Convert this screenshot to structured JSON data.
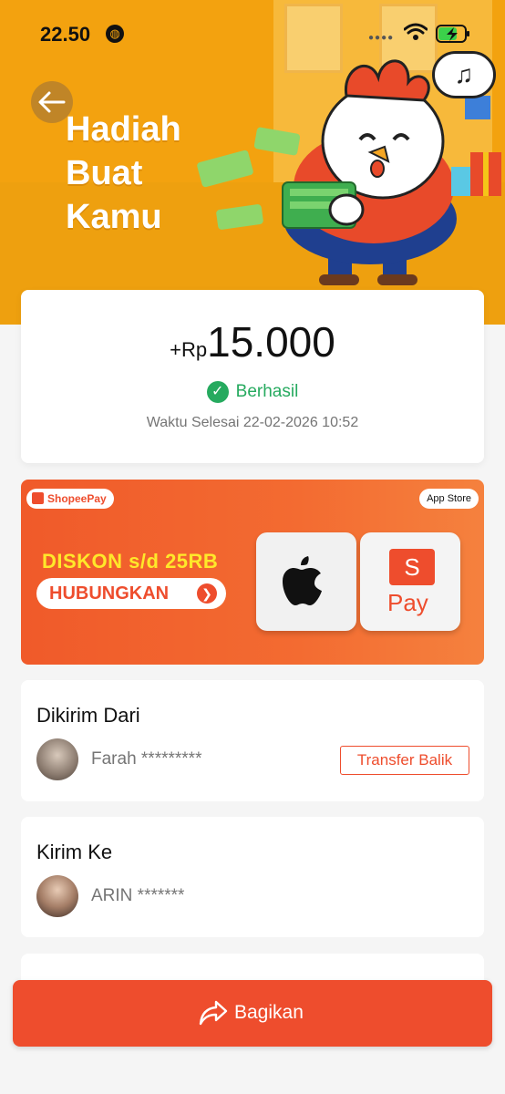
{
  "status_bar": {
    "time": "22.50"
  },
  "header": {
    "title_lines": [
      "Hadiah",
      "Buat",
      "Kamu"
    ],
    "music_glyph": "♫"
  },
  "summary": {
    "amount_prefix": "+Rp",
    "amount_value": "15.000",
    "status": "Berhasil",
    "completed_time": "Waktu Selesai 22-02-2026 10:52"
  },
  "promo": {
    "wallet_badge": "ShopeePay",
    "store_badge": "App Store",
    "discount": "DISKON s/d 25RB",
    "cta": "HUBUNGKAN",
    "pay_letter": "S",
    "pay_text": "Pay"
  },
  "sender": {
    "title": "Dikirim Dari",
    "name": "Farah *********",
    "action": "Transfer Balik"
  },
  "receiver": {
    "title": "Kirim Ke",
    "name": "ARIN *******"
  },
  "footer": {
    "share_label": "Bagikan"
  },
  "icons": {
    "back": "arrow-left-icon",
    "status_check": "check-circle-icon",
    "share": "share-arrow-icon",
    "cta_arrow": "chevron-right-icon"
  },
  "colors": {
    "brand": "#ee4d2d",
    "hero": "#f3a20f",
    "success": "#26aa5f",
    "discount_text": "#ffe82a"
  }
}
